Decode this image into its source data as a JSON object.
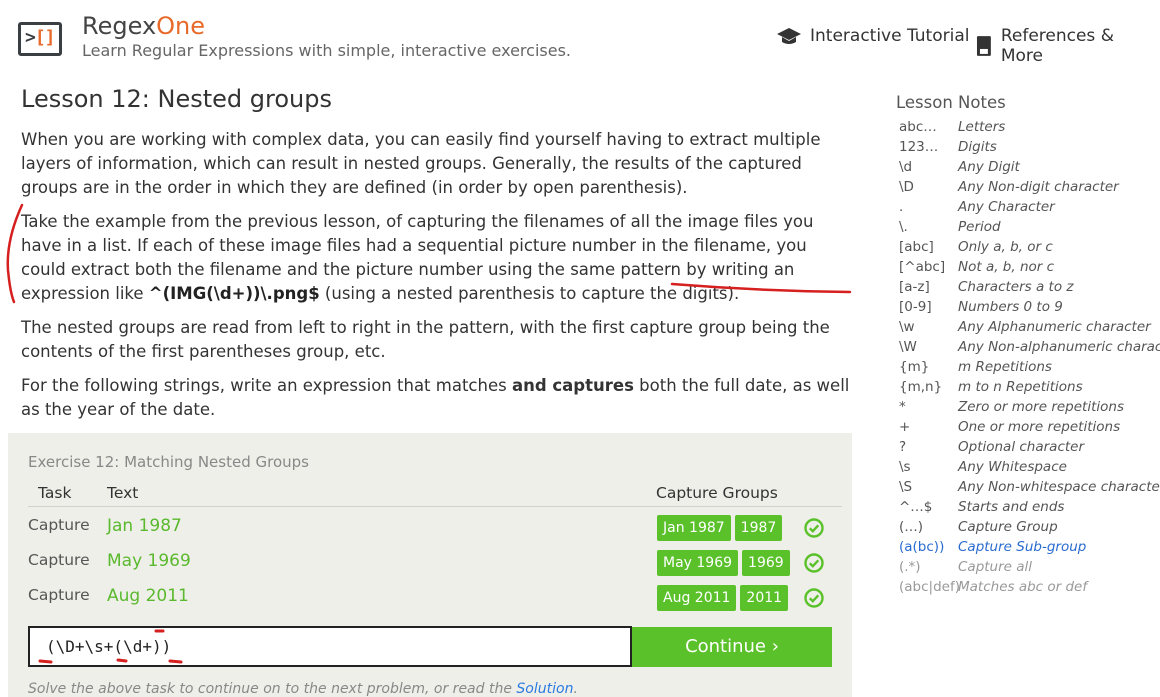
{
  "header": {
    "brand_main": "Regex",
    "brand_accent": "One",
    "tagline": "Learn Regular Expressions with simple, interactive exercises.",
    "nav": [
      {
        "label": "Interactive Tutorial",
        "icon": "graduation-cap-icon"
      },
      {
        "label": "References & More",
        "icon": "book-icon"
      }
    ]
  },
  "lesson": {
    "title": "Lesson 12: Nested groups",
    "p1": "When you are working with complex data, you can easily find yourself having to extract multiple layers of information, which can result in nested groups. Generally, the results of the captured groups are in the order in which they are defined (in order by open parenthesis).",
    "p2_before": "Take the example from the previous lesson, of capturing the filenames of all the image files you have in a list. If each of these image files had a sequential picture number in the filename, you could extract both the filename and the picture number using the same pattern by writing an expression like ",
    "p2_code": "^(IMG(\\d+))\\.png$",
    "p2_after": " (using a nested parenthesis to capture the digits).",
    "p3": "The nested groups are read from left to right in the pattern, with the first capture group being the contents of the first parentheses group, etc.",
    "p4_before": "For the following strings, write an expression that matches ",
    "p4_strong": "and captures",
    "p4_after": " both the full date, as well as the year of the date."
  },
  "exercise": {
    "title": "Exercise 12: Matching Nested Groups",
    "headers": {
      "task": "Task",
      "text": "Text",
      "capture": "Capture Groups"
    },
    "rows": [
      {
        "task": "Capture",
        "text": "Jan 1987",
        "groups": [
          "Jan 1987",
          "1987"
        ],
        "status": "check-circle-icon"
      },
      {
        "task": "Capture",
        "text": "May 1969",
        "groups": [
          "May 1969",
          "1969"
        ],
        "status": "check-circle-icon"
      },
      {
        "task": "Capture",
        "text": "Aug 2011",
        "groups": [
          "Aug 2011",
          "2011"
        ],
        "status": "check-circle-icon"
      }
    ],
    "input_value": "(\\D+\\s+(\\d+))",
    "continue_label": "Continue ›",
    "hint_before": "Solve the above task to continue on to the next problem, or read the ",
    "hint_link": "Solution",
    "hint_after": "."
  },
  "notes": {
    "title": "Lesson Notes",
    "items": [
      {
        "k": "abc…",
        "v": "Letters",
        "style": "normal"
      },
      {
        "k": "123…",
        "v": "Digits",
        "style": "normal"
      },
      {
        "k": "\\d",
        "v": "Any Digit",
        "style": "normal"
      },
      {
        "k": "\\D",
        "v": "Any Non-digit character",
        "style": "normal"
      },
      {
        "k": ".",
        "v": "Any Character",
        "style": "normal"
      },
      {
        "k": "\\.",
        "v": "Period",
        "style": "normal"
      },
      {
        "k": "[abc]",
        "v": "Only a, b, or c",
        "style": "normal"
      },
      {
        "k": "[^abc]",
        "v": "Not a, b, nor c",
        "style": "normal"
      },
      {
        "k": "[a-z]",
        "v": "Characters a to z",
        "style": "normal"
      },
      {
        "k": "[0-9]",
        "v": "Numbers 0 to 9",
        "style": "normal"
      },
      {
        "k": "\\w",
        "v": "Any Alphanumeric character",
        "style": "normal"
      },
      {
        "k": "\\W",
        "v": "Any Non-alphanumeric character",
        "style": "normal"
      },
      {
        "k": "{m}",
        "v": "m Repetitions",
        "style": "normal"
      },
      {
        "k": "{m,n}",
        "v": "m to n Repetitions",
        "style": "normal"
      },
      {
        "k": "*",
        "v": "Zero or more repetitions",
        "style": "normal"
      },
      {
        "k": "+",
        "v": "One or more repetitions",
        "style": "normal"
      },
      {
        "k": "?",
        "v": "Optional character",
        "style": "normal"
      },
      {
        "k": "\\s",
        "v": "Any Whitespace",
        "style": "normal"
      },
      {
        "k": "\\S",
        "v": "Any Non-whitespace character",
        "style": "normal"
      },
      {
        "k": "^…$",
        "v": "Starts and ends",
        "style": "normal"
      },
      {
        "k": "(…)",
        "v": "Capture Group",
        "style": "normal"
      },
      {
        "k": "(a(bc))",
        "v": "Capture Sub-group",
        "style": "blue"
      },
      {
        "k": "(.*)",
        "v": "Capture all",
        "style": "grey"
      },
      {
        "k": "(abc|def)",
        "v": "Matches abc or def",
        "style": "grey"
      }
    ]
  },
  "colors": {
    "accent_orange": "#e86a2a",
    "success_green": "#5ac12a",
    "link_blue": "#2a7ae2",
    "annotation_red": "#d61f1f"
  }
}
